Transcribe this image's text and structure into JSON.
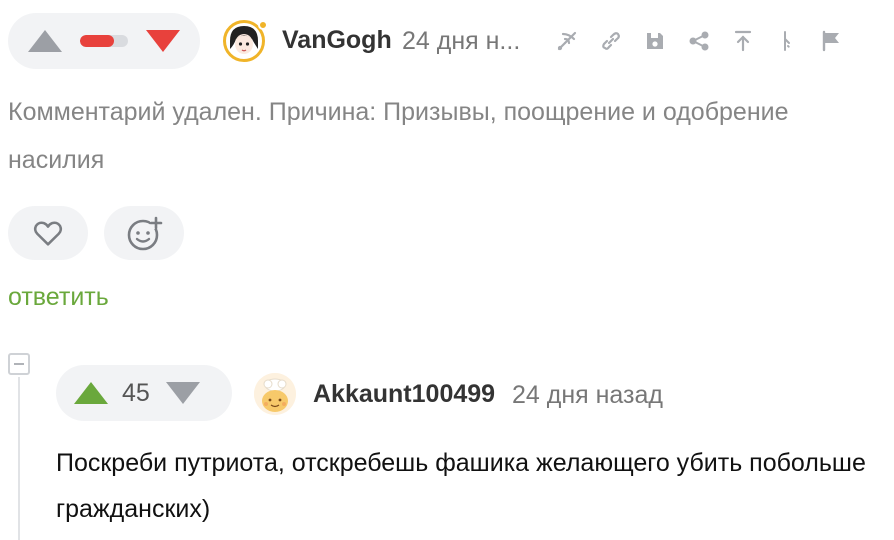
{
  "comment1": {
    "vote_rating_fraction": 0.7,
    "author": "VanGogh",
    "timestamp": "24 дня н...",
    "body": "Комментарий удален. Причина: Призывы, поощрение и одобрение насилия",
    "toolbar_icons": [
      "branch-icon",
      "link-icon",
      "save-icon",
      "share-icon",
      "scroll-top-icon",
      "parent-icon",
      "flag-icon"
    ],
    "reply_label": "ответить"
  },
  "comment2": {
    "score": "45",
    "author": "Akkaunt100499",
    "timestamp": "24 дня назад",
    "body": "Поскреби путриота, отскребешь фашика желающего убить побольше гражданских)"
  },
  "colors": {
    "upvote_active": "#6aa83c",
    "downvote_active": "#e8413c",
    "online_badge": "#f0b429",
    "reply_link": "#6aa83c"
  }
}
